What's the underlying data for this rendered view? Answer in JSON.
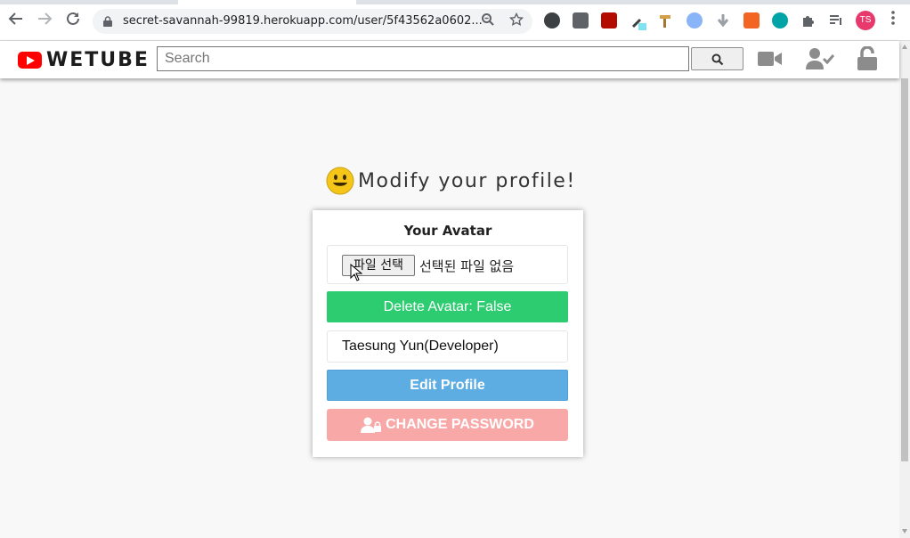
{
  "browser": {
    "url": "secret-savannah-99819.herokuapp.com/user/5f43562a0602...",
    "profile_initials": "TS"
  },
  "header": {
    "logo_text": "WETUBE",
    "search_placeholder": "Search"
  },
  "page": {
    "title": "Modify your profile!"
  },
  "form": {
    "avatar_label": "Your Avatar",
    "file_button": "파일 선택",
    "file_status": "선택된 파일 없음",
    "delete_avatar": "Delete Avatar: False",
    "name_value": "Taesung Yun(Developer)",
    "edit_profile": "Edit Profile",
    "change_password": "CHANGE PASSWORD"
  },
  "colors": {
    "brand_red": "#ff0000",
    "delete_green": "#2ecc71",
    "edit_blue": "#5dade2",
    "password_pink": "#f9a8a8",
    "header_icon_gray": "#8c8c8c"
  },
  "icons": {
    "header": [
      "video-camera-icon",
      "user-check-icon",
      "unlock-icon"
    ],
    "title": "smiley-face-icon",
    "password": "user-lock-icon"
  }
}
